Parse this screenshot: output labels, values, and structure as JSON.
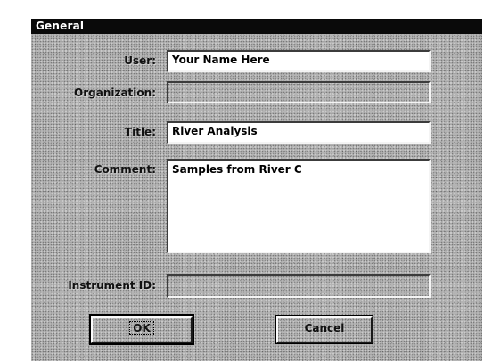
{
  "dialog": {
    "title": "General"
  },
  "fields": {
    "user": {
      "label": "User:",
      "value": "Your Name Here"
    },
    "organization": {
      "label": "Organization:",
      "value": ""
    },
    "title": {
      "label": "Title:",
      "value": "River Analysis"
    },
    "comment": {
      "label": "Comment:",
      "value": "Samples from River C"
    },
    "instrument_id": {
      "label": "Instrument ID:",
      "value": ""
    }
  },
  "buttons": {
    "ok_label": "OK",
    "cancel_label": "Cancel"
  }
}
